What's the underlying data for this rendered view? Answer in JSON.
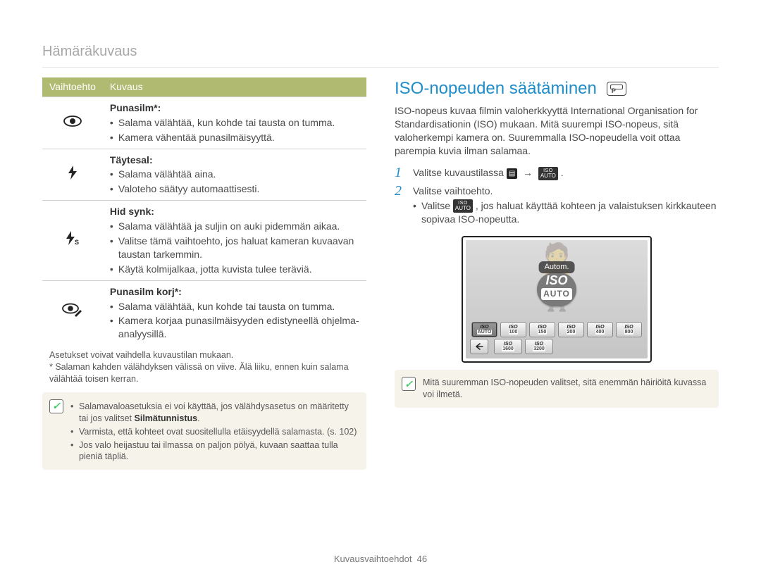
{
  "header": {
    "title": "Hämäräkuvaus"
  },
  "table": {
    "head": {
      "col1": "Vaihtoehto",
      "col2": "Kuvaus"
    },
    "rows": [
      {
        "icon": "eye-icon",
        "unicode": "👁",
        "title": "Punasilm*:",
        "bullets": [
          "Salama välähtää, kun kohde tai tausta on tumma.",
          "Kamera vähentää punasilmäisyyttä."
        ]
      },
      {
        "icon": "flash-icon",
        "unicode": "⚡",
        "title": "Täytesal:",
        "bullets": [
          "Salama välähtää aina.",
          "Valoteho säätyy automaattisesti."
        ]
      },
      {
        "icon": "flash-s-icon",
        "unicode": "⚡ˢ",
        "title": "Hid synk:",
        "bullets": [
          "Salama välähtää ja suljin on auki pidemmän aikaa.",
          "Valitse tämä vaihtoehto, jos haluat kameran kuvaavan taustan tarkemmin.",
          "Käytä kolmijalkaa, jotta kuvista tulee teräviä."
        ]
      },
      {
        "icon": "eye-pencil-icon",
        "unicode": "👁✎",
        "title": "Punasilm korj*:",
        "bullets": [
          "Salama välähtää, kun kohde tai tausta on tumma.",
          "Kamera korjaa punasilmäisyyden edistyneellä ohjelma-analyysillä."
        ]
      }
    ]
  },
  "footnotes": [
    "Asetukset voivat vaihdella kuvaustilan mukaan.",
    "* Salaman kahden välähdyksen välissä on viive. Älä liiku, ennen kuin salama välähtää toisen kerran."
  ],
  "note_left": {
    "bullets": [
      {
        "plain_before": "Salamavaloasetuksia ei voi käyttää, jos välähdysasetus on määritetty tai jos valitset ",
        "bold": "Silmätunnistus",
        "plain_after": "."
      },
      {
        "plain_before": "Varmista, että kohteet ovat suositellulla etäisyydellä salamasta. (s. 102)",
        "bold": "",
        "plain_after": ""
      },
      {
        "plain_before": "Jos valo heijastuu tai ilmassa on paljon pölyä, kuvaan saattaa tulla pieniä täpliä.",
        "bold": "",
        "plain_after": ""
      }
    ]
  },
  "section": {
    "title": "ISO-nopeuden säätäminen",
    "intro": "ISO-nopeus kuvaa filmin valoherkkyyttä International Organisation for Standardisationin (ISO) mukaan. Mitä suurempi ISO-nopeus, sitä valoherkempi kamera on. Suuremmalla ISO-nopeudella voit ottaa parempia kuvia ilman salamaa.",
    "step1": {
      "text_before": "Valitse kuvaustilassa ",
      "text_after": "."
    },
    "step2": {
      "text": "Valitse vaihtoehto.",
      "sub_before": "Valitse ",
      "sub_after": ", jos haluat käyttää kohteen ja valaistuksen kirkkauteen sopivaa ISO-nopeutta."
    }
  },
  "note_right": {
    "text": "Mitä suuremman ISO-nopeuden valitset, sitä enemmän häiriöitä kuvassa voi ilmetä."
  },
  "lcd": {
    "label": "Autom.",
    "big_iso": "ISO",
    "big_auto": "AUTO",
    "row1": [
      {
        "l1": "ISO",
        "l2": "AUTO",
        "selected": true
      },
      {
        "l1": "ISO",
        "l2": "100",
        "selected": false
      },
      {
        "l1": "ISO",
        "l2": "150",
        "selected": false
      },
      {
        "l1": "ISO",
        "l2": "200",
        "selected": false
      },
      {
        "l1": "ISO",
        "l2": "400",
        "selected": false
      },
      {
        "l1": "ISO",
        "l2": "800",
        "selected": false
      }
    ],
    "row2": [
      {
        "l1": "ISO",
        "l2": "1600",
        "selected": false
      },
      {
        "l1": "ISO",
        "l2": "3200",
        "selected": false
      }
    ]
  },
  "footer": {
    "section_label": "Kuvausvaihtoehdot",
    "page": "46"
  }
}
